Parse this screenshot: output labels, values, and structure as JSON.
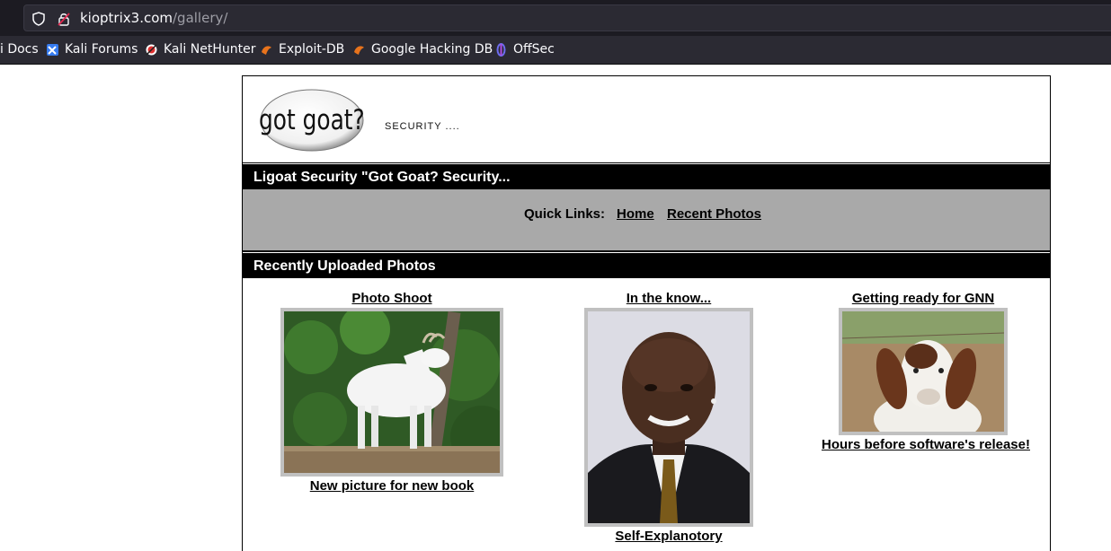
{
  "browser": {
    "url_host": "kioptrix3.com",
    "url_path": "/gallery/",
    "bookmarks": [
      {
        "label": "i Docs",
        "icon": "docs-icon"
      },
      {
        "label": "Kali Forums",
        "icon": "kali-forums-icon"
      },
      {
        "label": "Kali NetHunter",
        "icon": "nethunter-icon"
      },
      {
        "label": "Exploit-DB",
        "icon": "exploit-db-icon"
      },
      {
        "label": "Google Hacking DB",
        "icon": "ghdb-icon"
      },
      {
        "label": "OffSec",
        "icon": "offsec-icon"
      }
    ]
  },
  "site": {
    "logo_text": "got goat?",
    "tagline": "SECURITY ....",
    "title_bar": "Ligoat Security \"Got Goat? Security...",
    "quick_links_label": "Quick Links:",
    "quick_links": [
      "Home",
      "Recent Photos"
    ],
    "section_title": "Recently Uploaded Photos"
  },
  "gallery": [
    {
      "title": "Photo Shoot",
      "caption": "New picture for new book",
      "image": "white-goat-photo"
    },
    {
      "title": "In the know...",
      "caption": "Self-Explanotory",
      "image": "man-portrait-photo"
    },
    {
      "title": "Getting ready for GNN",
      "caption": "Hours before software's release!",
      "image": "brown-goat-photo"
    }
  ],
  "colors": {
    "chrome_bg": "#1c1b22",
    "bar_bg": "#000000",
    "quicklinks_bg": "#a9a9a9",
    "frame_border": "#c0c0c0"
  }
}
